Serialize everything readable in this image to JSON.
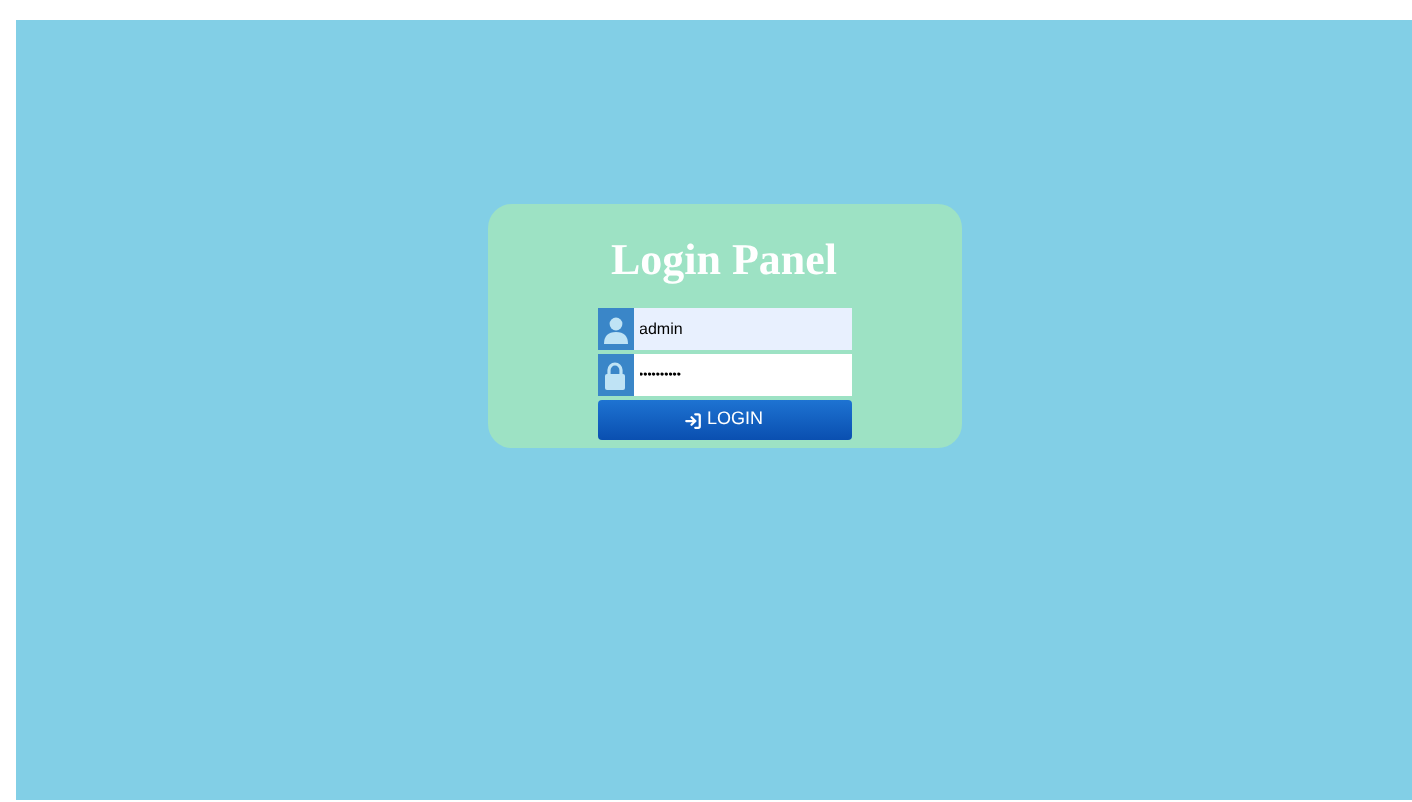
{
  "panel": {
    "title": "Login Panel"
  },
  "username": {
    "value": "admin"
  },
  "password": {
    "value": "••••••••••"
  },
  "login_button": {
    "label": "LOGIN"
  }
}
